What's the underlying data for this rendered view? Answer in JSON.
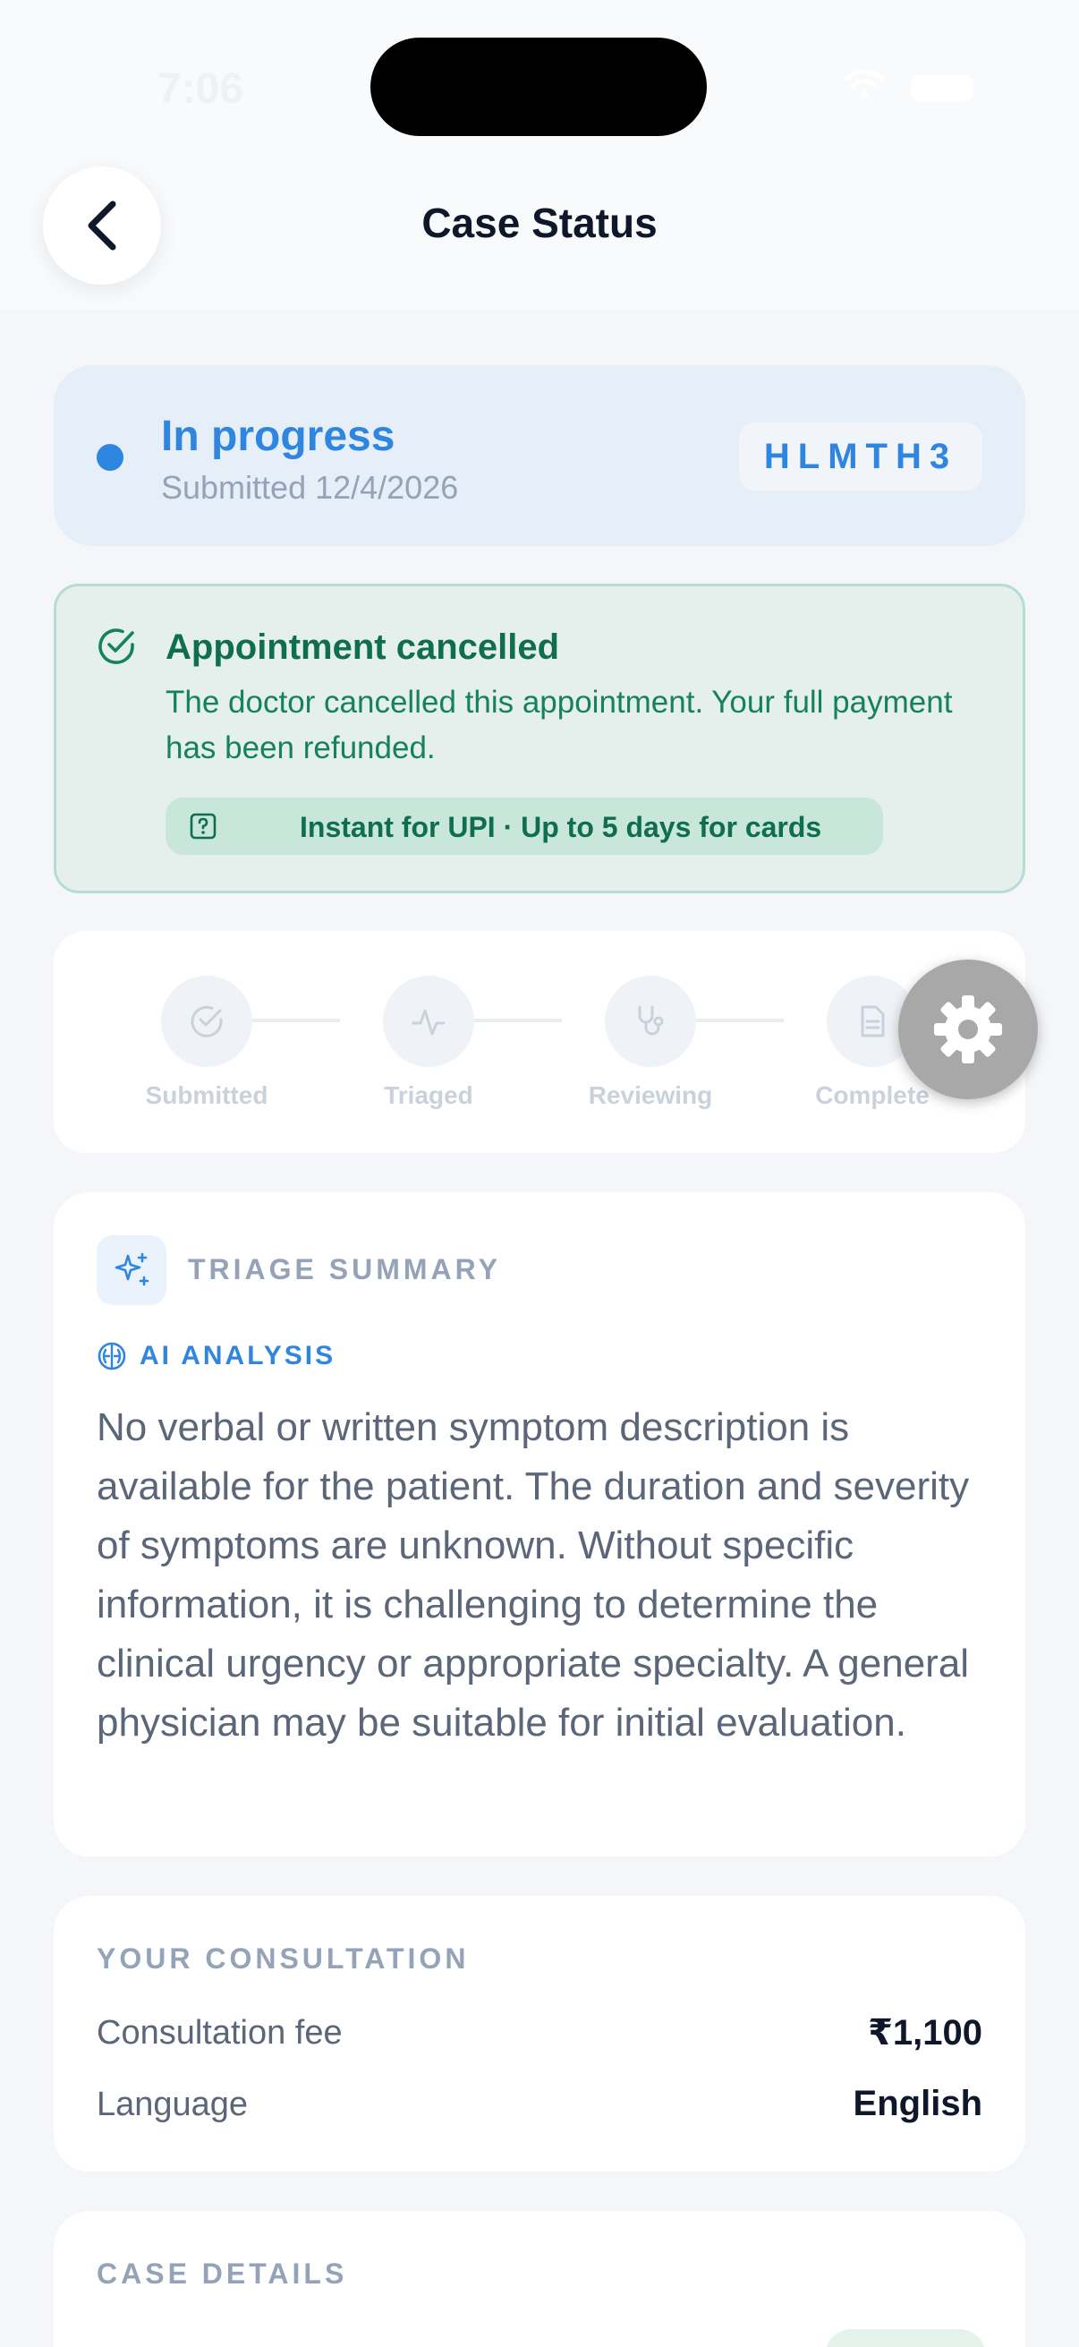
{
  "status_bar": {
    "time": "7:06"
  },
  "header": {
    "title": "Case Status"
  },
  "status": {
    "label": "In progress",
    "submitted": "Submitted 12/4/2026",
    "case_code": "HLMTH3",
    "accent": "#2f86e0"
  },
  "cancellation": {
    "title": "Appointment cancelled",
    "message": "The doctor cancelled this appointment. Your full payment has been refunded.",
    "refund_note": "Instant for UPI · Up to 5 days for cards",
    "color": "#0f6e4f"
  },
  "steps": [
    {
      "label": "Submitted",
      "icon": "check-circle-icon"
    },
    {
      "label": "Triaged",
      "icon": "activity-icon"
    },
    {
      "label": "Reviewing",
      "icon": "stethoscope-icon"
    },
    {
      "label": "Complete",
      "icon": "document-icon"
    }
  ],
  "triage": {
    "heading": "TRIAGE SUMMARY",
    "ai_label": "AI ANALYSIS",
    "text": "No verbal or written symptom description is available for the patient. The duration and severity of symptoms are unknown. Without specific information, it is challenging to determine the clinical urgency or appropriate specialty. A general physician may be suitable for initial evaluation."
  },
  "consultation": {
    "heading": "YOUR CONSULTATION",
    "fee_label": "Consultation fee",
    "fee_value": "₹1,100",
    "language_label": "Language",
    "language_value": "English"
  },
  "case_details": {
    "heading": "CASE DETAILS"
  }
}
